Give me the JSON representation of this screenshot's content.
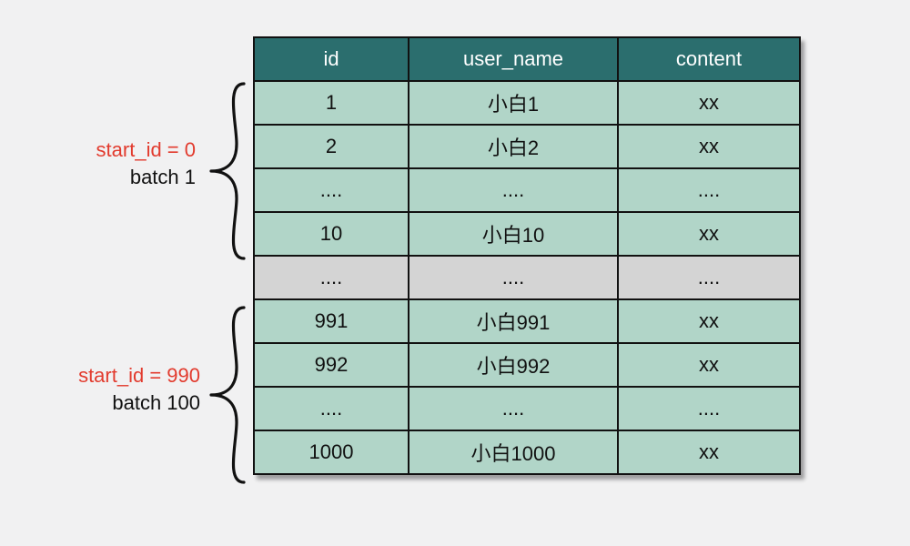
{
  "table": {
    "headers": [
      "id",
      "user_name",
      "content"
    ],
    "batch1": {
      "label_start": "start_id = 0",
      "label_batch": "batch 1",
      "rows": [
        [
          "1",
          "小白1",
          "xx"
        ],
        [
          "2",
          "小白2",
          "xx"
        ],
        [
          "....",
          "....",
          "...."
        ],
        [
          "10",
          "小白10",
          "xx"
        ]
      ]
    },
    "gap_row": [
      "....",
      "....",
      "...."
    ],
    "batch100": {
      "label_start": "start_id = 990",
      "label_batch": "batch 100",
      "rows": [
        [
          "991",
          "小白991",
          "xx"
        ],
        [
          "992",
          "小白992",
          "xx"
        ],
        [
          "....",
          "....",
          "...."
        ],
        [
          "1000",
          "小白1000",
          "xx"
        ]
      ]
    }
  }
}
